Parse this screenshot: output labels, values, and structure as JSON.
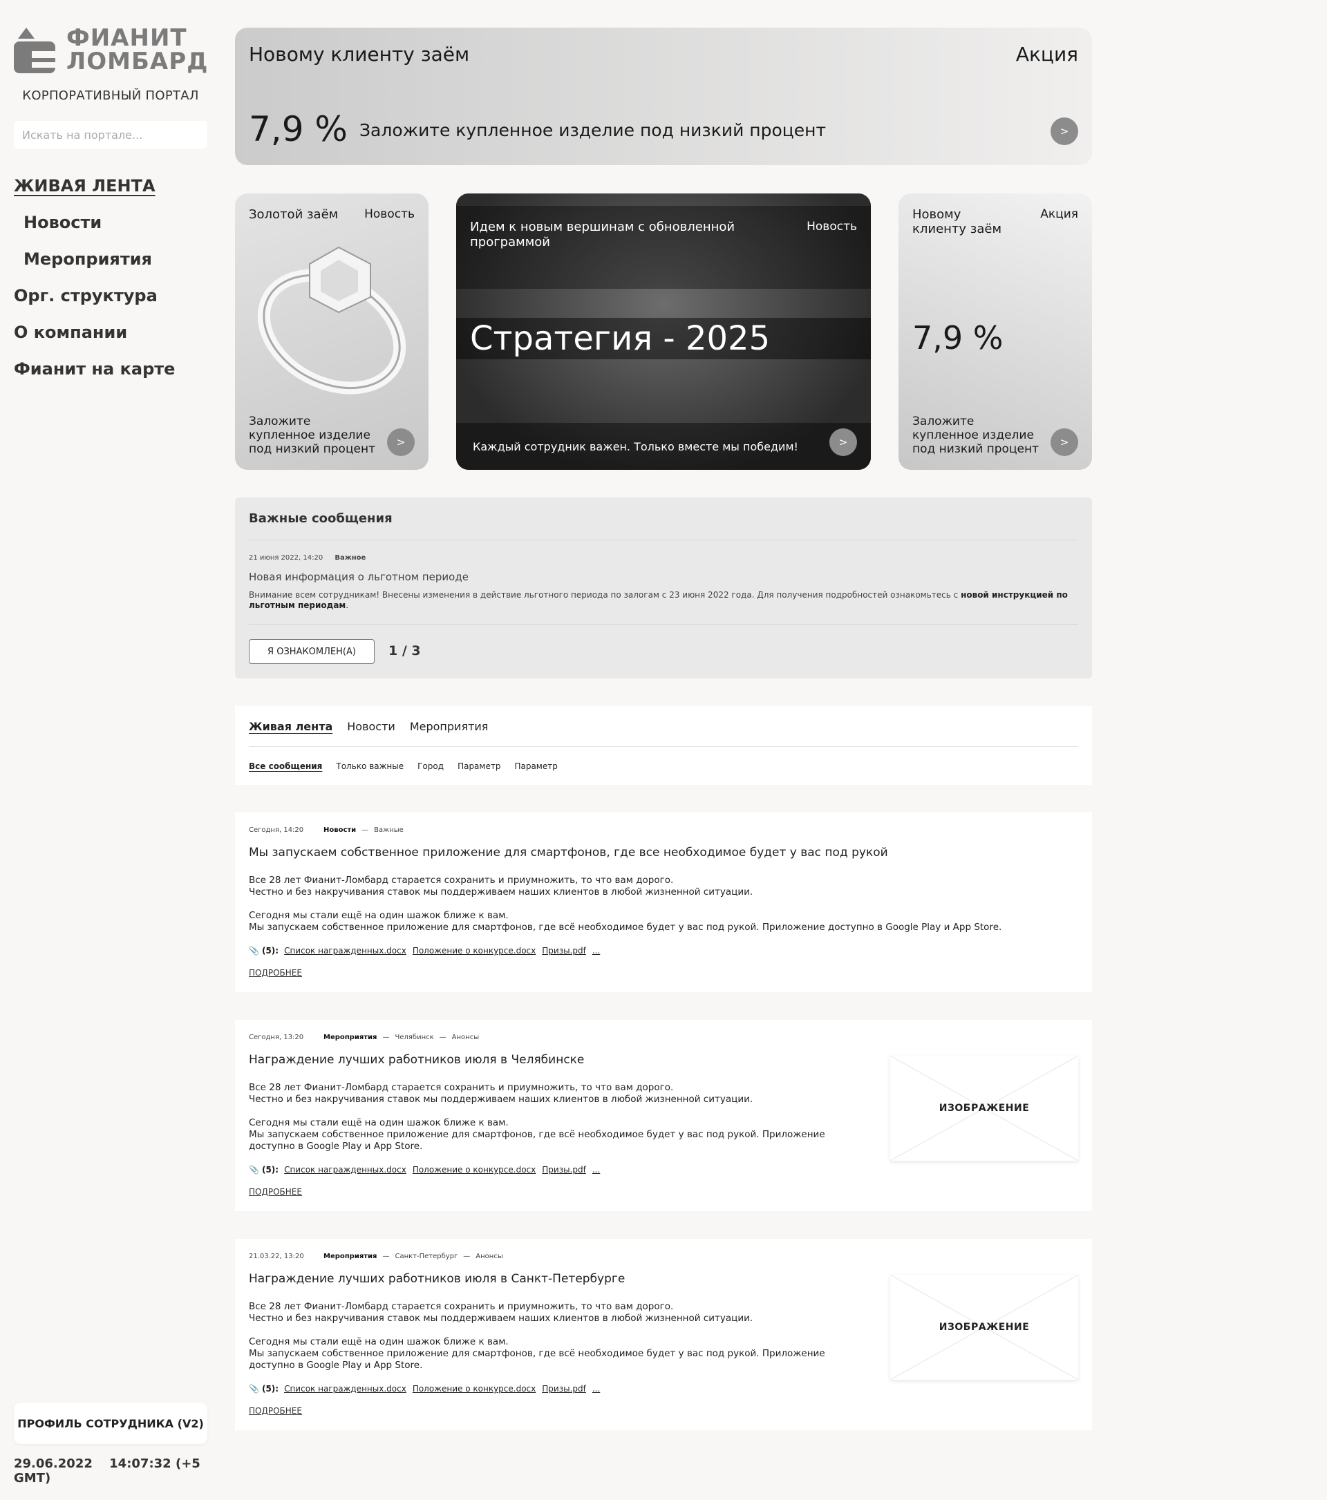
{
  "sidebar": {
    "logo_line1": "ФИАНИТ",
    "logo_line2": "ЛОМБАРД",
    "caption": "КОРПОРАТИВНЫЙ ПОРТАЛ",
    "search_placeholder": "Искать на портале...",
    "nav": {
      "feed": "ЖИВАЯ ЛЕНТА",
      "news": "Новости",
      "events": "Мероприятия",
      "org": "Орг. структура",
      "about": "О компании",
      "map": "Фианит на карте"
    },
    "profile_button": "ПРОФИЛЬ СОТРУДНИКА (V2)",
    "date": "29.06.2022",
    "time": "14:07:32 (+5 GMT)"
  },
  "promo": {
    "title": "Новому клиенту заём",
    "tag": "Акция",
    "percent": "7,9 %",
    "desc": "Заложите купленное изделие под низкий процент",
    "button": ">"
  },
  "cards": {
    "gold": {
      "title": "Золотой заём",
      "tag": "Новость",
      "desc": "Заложите купленное изделие под низкий процент",
      "button": ">"
    },
    "strategy": {
      "title": "Идем к новым вершинам с обновленной программой",
      "tag": "Новость",
      "big": "Стратегия - 2025",
      "footer": "Каждый сотрудник важен. Только вместе мы победим!",
      "button": ">"
    },
    "newclient": {
      "title": "Новому клиенту заём",
      "tag": "Акция",
      "percent": "7,9 %",
      "desc": "Заложите купленное изделие под низкий процент",
      "button": ">"
    }
  },
  "important": {
    "heading": "Важные сообщения",
    "date": "21 июня 2022, 14:20",
    "label": "Важное",
    "title": "Новая информация о льготном периоде",
    "text": "Внимание всем сотрудникам! Внесены изменения в действие льготного периода по залогам с 23 июня 2022 года. Для получения подробностей ознакомьтесь с ",
    "link": "новой инструкцией по льготным периодам",
    "ack_button": "Я ОЗНАКОМЛЕН(А)",
    "pager": "1 / 3"
  },
  "tabs": {
    "items": [
      "Живая лента",
      "Новости",
      "Мероприятия"
    ],
    "filters": [
      "Все сообщения",
      "Только важные",
      "Город",
      "Параметр",
      "Параметр"
    ]
  },
  "posts": [
    {
      "date": "Сегодня, 14:20",
      "category": "Новости",
      "tags": [
        "Важные"
      ],
      "title": "Мы запускаем собственное приложение для смартфонов, где все необходимое будет у вас под рукой",
      "p1": "Все 28 лет Фианит-Ломбард старается сохранить и приумножить, то что вам дорого.\nЧестно и без накручивания ставок мы поддерживаем наших клиентов в любой жизненной ситуации.",
      "p2": "Сегодня мы стали ещё на один шажок ближе к вам.\nМы запускаем собственное приложение для смартфонов, где всё необходимое будет у вас под рукой. Приложение доступно в Google Play и App Store.",
      "attach_count": "(5):",
      "files": [
        "Список награжденных.docx",
        "Положение о конкурсе.docx",
        "Призы.pdf",
        "..."
      ],
      "more": "ПОДРОБНЕЕ"
    },
    {
      "date": "Сегодня, 13:20",
      "category": "Мероприятия",
      "tags": [
        "Челябинск",
        "Анонсы"
      ],
      "title": "Награждение лучших работников июля в Челябинске",
      "p1": "Все 28 лет Фианит-Ломбард старается сохранить и приумножить, то что вам дорого.\nЧестно и без накручивания ставок мы поддерживаем наших клиентов в любой жизненной ситуации.",
      "p2": "Сегодня мы стали ещё на один шажок ближе к вам.\nМы запускаем собственное приложение для смартфонов, где всё необходимое будет у вас под рукой. Приложение доступно в Google Play и App Store.",
      "attach_count": "(5):",
      "files": [
        "Список награжденных.docx",
        "Положение о конкурсе.docx",
        "Призы.pdf",
        "..."
      ],
      "image": "ИЗОБРАЖЕНИЕ",
      "more": "ПОДРОБНЕЕ"
    },
    {
      "date": "21.03.22, 13:20",
      "category": "Мероприятия",
      "tags": [
        "Санкт-Петербург",
        "Анонсы"
      ],
      "title": "Награждение лучших работников июля в Санкт-Петербурге",
      "p1": "Все 28 лет Фианит-Ломбард старается сохранить и приумножить, то что вам дорого.\nЧестно и без накручивания ставок мы поддерживаем наших клиентов в любой жизненной ситуации.",
      "p2": "Сегодня мы стали ещё на один шажок ближе к вам.\nМы запускаем собственное приложение для смартфонов, где всё необходимое будет у вас под рукой. Приложение доступно в Google Play и App Store.",
      "attach_count": "(5):",
      "files": [
        "Список награжденных.docx",
        "Положение о конкурсе.docx",
        "Призы.pdf",
        "..."
      ],
      "image": "ИЗОБРАЖЕНИЕ",
      "more": "ПОДРОБНЕЕ"
    }
  ]
}
